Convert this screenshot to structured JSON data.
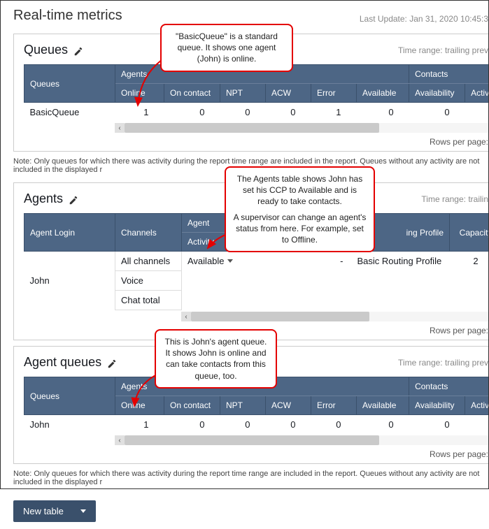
{
  "header": {
    "title": "Real-time metrics",
    "last_update": "Last Update: Jan 31, 2020 10:45:3"
  },
  "queues_panel": {
    "title": "Queues",
    "time_range": "Time range: trailing prev",
    "group_col": "Queues",
    "agents_group": "Agents",
    "contacts_group": "Contacts",
    "cols": {
      "online": "Online",
      "on_contact": "On contact",
      "npt": "NPT",
      "acw": "ACW",
      "error": "Error",
      "available": "Available",
      "availability": "Availability",
      "active": "Active"
    },
    "row": {
      "name": "BasicQueue",
      "online": "1",
      "on_contact": "0",
      "npt": "0",
      "acw": "0",
      "error": "1",
      "available": "0",
      "availability": "0"
    },
    "rows_per_page": "Rows per page:"
  },
  "note_text": "Note: Only queues for which there was activity during the report time range are included in the report. Queues without any activity are not included in the displayed r",
  "agents_panel": {
    "title": "Agents",
    "time_range": "Time range: trailin",
    "cols": {
      "login": "Agent Login",
      "channels": "Channels",
      "agent_group": "Agent",
      "activity": "Activity",
      "routing": "ing Profile",
      "capacity": "Capacity"
    },
    "row": {
      "login": "John",
      "channels": [
        "All channels",
        "Voice",
        "Chat total"
      ],
      "activity": "Available",
      "dash": "-",
      "routing": "Basic Routing Profile",
      "capacity": "2"
    },
    "rows_per_page": "Rows per page:"
  },
  "agent_queues_panel": {
    "title": "Agent queues",
    "time_range": "Time range: trailing prev",
    "group_col": "Queues",
    "agents_group": "Agents",
    "contacts_group": "Contacts",
    "cols": {
      "online": "Online",
      "on_contact": "On contact",
      "npt": "NPT",
      "acw": "ACW",
      "error": "Error",
      "available": "Available",
      "availability": "Availability",
      "active": "Active"
    },
    "row": {
      "name": "John",
      "online": "1",
      "on_contact": "0",
      "npt": "0",
      "acw": "0",
      "error": "0",
      "available": "0",
      "availability": "0"
    },
    "rows_per_page": "Rows per page:"
  },
  "callouts": {
    "c1": "\"BasicQueue\" is a standard queue. It shows one agent (John) is online.",
    "c2a": "The Agents table shows John has set his CCP to Available and is ready to take contacts.",
    "c2b": "A supervisor can change an agent's status from here. For example, set to Offline.",
    "c3": "This is John's agent queue. It shows John is online and can take contacts from this queue, too."
  },
  "new_table": "New table"
}
